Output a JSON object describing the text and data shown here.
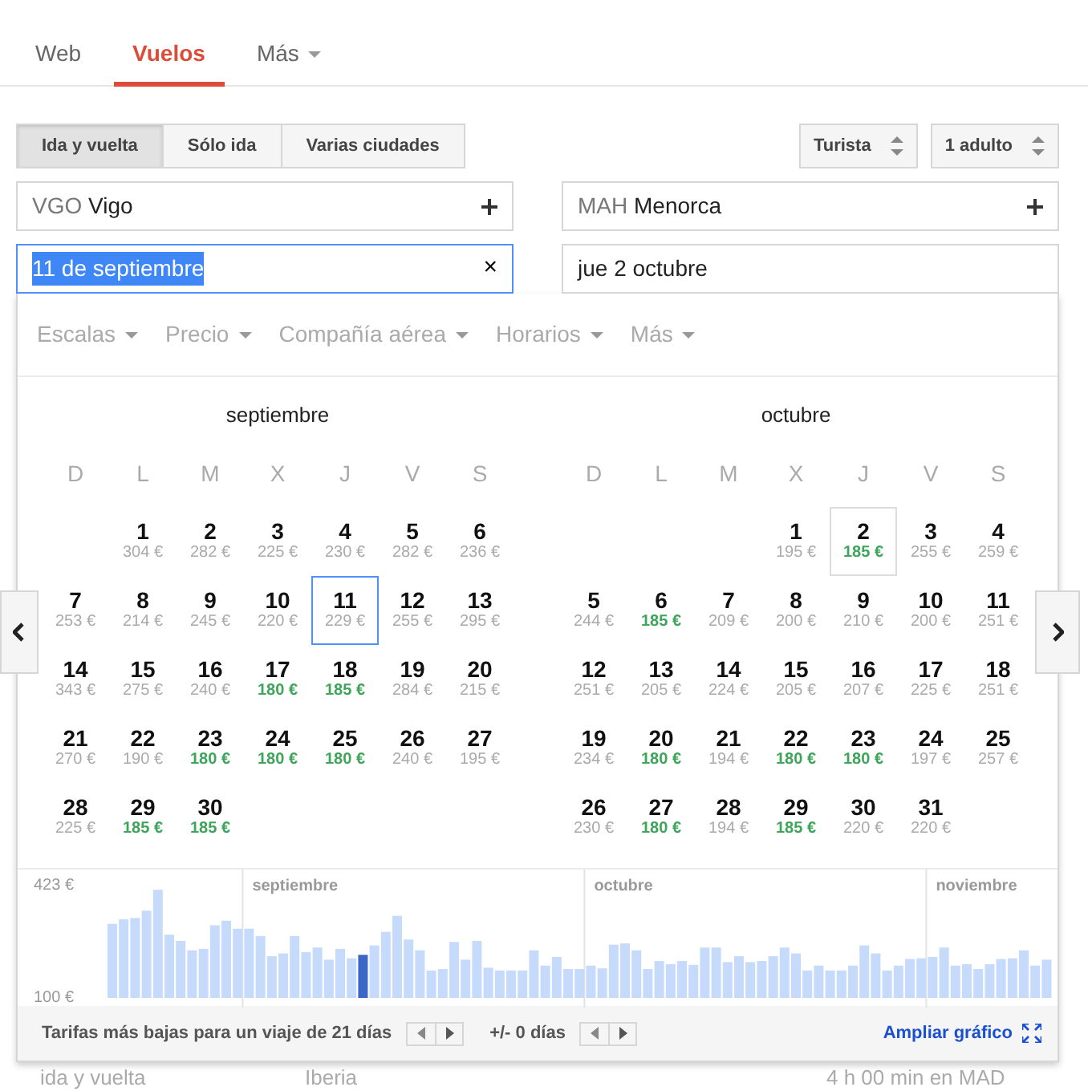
{
  "tabs": [
    {
      "label": "Web",
      "selected": false,
      "dropdown": false
    },
    {
      "label": "Vuelos",
      "selected": true,
      "dropdown": false
    },
    {
      "label": "Más",
      "selected": false,
      "dropdown": true
    }
  ],
  "trip_types": [
    {
      "label": "Ida y vuelta",
      "selected": true
    },
    {
      "label": "Sólo ida",
      "selected": false
    },
    {
      "label": "Varias ciudades",
      "selected": false
    }
  ],
  "selectors": [
    "Turista",
    "1 adulto"
  ],
  "origin": {
    "code": "VGO",
    "city": "Vigo"
  },
  "destination": {
    "code": "MAH",
    "city": "Menorca"
  },
  "departure_date": {
    "value": "11 de septiembre",
    "focused": true,
    "clear": "×"
  },
  "return_date": {
    "value": "jue 2 octubre"
  },
  "filters": [
    "Escalas",
    "Precio",
    "Compañía aérea",
    "Horarios",
    "Más"
  ],
  "months": [
    {
      "name": "septiembre",
      "weekdays": [
        "D",
        "L",
        "M",
        "X",
        "J",
        "V",
        "S"
      ],
      "weeks": [
        [
          {
            "kind": "blank"
          },
          {
            "kind": "day",
            "day": "1",
            "price": "304 €",
            "cheap": false,
            "selected": false,
            "return": false
          },
          {
            "kind": "day",
            "day": "2",
            "price": "282 €",
            "cheap": false,
            "selected": false,
            "return": false
          },
          {
            "kind": "day",
            "day": "3",
            "price": "225 €",
            "cheap": false,
            "selected": false,
            "return": false
          },
          {
            "kind": "day",
            "day": "4",
            "price": "230 €",
            "cheap": false,
            "selected": false,
            "return": false
          },
          {
            "kind": "day",
            "day": "5",
            "price": "282 €",
            "cheap": false,
            "selected": false,
            "return": false
          },
          {
            "kind": "day",
            "day": "6",
            "price": "236 €",
            "cheap": false,
            "selected": false,
            "return": false
          }
        ],
        [
          {
            "kind": "day",
            "day": "7",
            "price": "253 €",
            "cheap": false,
            "selected": false,
            "return": false
          },
          {
            "kind": "day",
            "day": "8",
            "price": "214 €",
            "cheap": false,
            "selected": false,
            "return": false
          },
          {
            "kind": "day",
            "day": "9",
            "price": "245 €",
            "cheap": false,
            "selected": false,
            "return": false
          },
          {
            "kind": "day",
            "day": "10",
            "price": "220 €",
            "cheap": false,
            "selected": false,
            "return": false
          },
          {
            "kind": "day",
            "day": "11",
            "price": "229 €",
            "cheap": false,
            "selected": true,
            "return": false
          },
          {
            "kind": "day",
            "day": "12",
            "price": "255 €",
            "cheap": false,
            "selected": false,
            "return": false
          },
          {
            "kind": "day",
            "day": "13",
            "price": "295 €",
            "cheap": false,
            "selected": false,
            "return": false
          }
        ],
        [
          {
            "kind": "day",
            "day": "14",
            "price": "343 €",
            "cheap": false,
            "selected": false,
            "return": false
          },
          {
            "kind": "day",
            "day": "15",
            "price": "275 €",
            "cheap": false,
            "selected": false,
            "return": false
          },
          {
            "kind": "day",
            "day": "16",
            "price": "240 €",
            "cheap": false,
            "selected": false,
            "return": false
          },
          {
            "kind": "day",
            "day": "17",
            "price": "180 €",
            "cheap": true,
            "selected": false,
            "return": false
          },
          {
            "kind": "day",
            "day": "18",
            "price": "185 €",
            "cheap": true,
            "selected": false,
            "return": false
          },
          {
            "kind": "day",
            "day": "19",
            "price": "284 €",
            "cheap": false,
            "selected": false,
            "return": false
          },
          {
            "kind": "day",
            "day": "20",
            "price": "215 €",
            "cheap": false,
            "selected": false,
            "return": false
          }
        ],
        [
          {
            "kind": "day",
            "day": "21",
            "price": "270 €",
            "cheap": false,
            "selected": false,
            "return": false
          },
          {
            "kind": "day",
            "day": "22",
            "price": "190 €",
            "cheap": false,
            "selected": false,
            "return": false
          },
          {
            "kind": "day",
            "day": "23",
            "price": "180 €",
            "cheap": true,
            "selected": false,
            "return": false
          },
          {
            "kind": "day",
            "day": "24",
            "price": "180 €",
            "cheap": true,
            "selected": false,
            "return": false
          },
          {
            "kind": "day",
            "day": "25",
            "price": "180 €",
            "cheap": true,
            "selected": false,
            "return": false
          },
          {
            "kind": "day",
            "day": "26",
            "price": "240 €",
            "cheap": false,
            "selected": false,
            "return": false
          },
          {
            "kind": "day",
            "day": "27",
            "price": "195 €",
            "cheap": false,
            "selected": false,
            "return": false
          }
        ],
        [
          {
            "kind": "day",
            "day": "28",
            "price": "225 €",
            "cheap": false,
            "selected": false,
            "return": false
          },
          {
            "kind": "day",
            "day": "29",
            "price": "185 €",
            "cheap": true,
            "selected": false,
            "return": false
          },
          {
            "kind": "day",
            "day": "30",
            "price": "185 €",
            "cheap": true,
            "selected": false,
            "return": false
          }
        ]
      ]
    },
    {
      "name": "octubre",
      "weekdays": [
        "D",
        "L",
        "M",
        "X",
        "J",
        "V",
        "S"
      ],
      "weeks": [
        [
          {
            "kind": "blank"
          },
          {
            "kind": "blank"
          },
          {
            "kind": "blank"
          },
          {
            "kind": "day",
            "day": "1",
            "price": "195 €",
            "cheap": false,
            "selected": false,
            "return": false
          },
          {
            "kind": "day",
            "day": "2",
            "price": "185 €",
            "cheap": true,
            "selected": false,
            "return": true
          },
          {
            "kind": "day",
            "day": "3",
            "price": "255 €",
            "cheap": false,
            "selected": false,
            "return": false
          },
          {
            "kind": "day",
            "day": "4",
            "price": "259 €",
            "cheap": false,
            "selected": false,
            "return": false
          }
        ],
        [
          {
            "kind": "day",
            "day": "5",
            "price": "244 €",
            "cheap": false,
            "selected": false,
            "return": false
          },
          {
            "kind": "day",
            "day": "6",
            "price": "185 €",
            "cheap": true,
            "selected": false,
            "return": false
          },
          {
            "kind": "day",
            "day": "7",
            "price": "209 €",
            "cheap": false,
            "selected": false,
            "return": false
          },
          {
            "kind": "day",
            "day": "8",
            "price": "200 €",
            "cheap": false,
            "selected": false,
            "return": false
          },
          {
            "kind": "day",
            "day": "9",
            "price": "210 €",
            "cheap": false,
            "selected": false,
            "return": false
          },
          {
            "kind": "day",
            "day": "10",
            "price": "200 €",
            "cheap": false,
            "selected": false,
            "return": false
          },
          {
            "kind": "day",
            "day": "11",
            "price": "251 €",
            "cheap": false,
            "selected": false,
            "return": false
          }
        ],
        [
          {
            "kind": "day",
            "day": "12",
            "price": "251 €",
            "cheap": false,
            "selected": false,
            "return": false
          },
          {
            "kind": "day",
            "day": "13",
            "price": "205 €",
            "cheap": false,
            "selected": false,
            "return": false
          },
          {
            "kind": "day",
            "day": "14",
            "price": "224 €",
            "cheap": false,
            "selected": false,
            "return": false
          },
          {
            "kind": "day",
            "day": "15",
            "price": "205 €",
            "cheap": false,
            "selected": false,
            "return": false
          },
          {
            "kind": "day",
            "day": "16",
            "price": "207 €",
            "cheap": false,
            "selected": false,
            "return": false
          },
          {
            "kind": "day",
            "day": "17",
            "price": "225 €",
            "cheap": false,
            "selected": false,
            "return": false
          },
          {
            "kind": "day",
            "day": "18",
            "price": "251 €",
            "cheap": false,
            "selected": false,
            "return": false
          }
        ],
        [
          {
            "kind": "day",
            "day": "19",
            "price": "234 €",
            "cheap": false,
            "selected": false,
            "return": false
          },
          {
            "kind": "day",
            "day": "20",
            "price": "180 €",
            "cheap": true,
            "selected": false,
            "return": false
          },
          {
            "kind": "day",
            "day": "21",
            "price": "194 €",
            "cheap": false,
            "selected": false,
            "return": false
          },
          {
            "kind": "day",
            "day": "22",
            "price": "180 €",
            "cheap": true,
            "selected": false,
            "return": false
          },
          {
            "kind": "day",
            "day": "23",
            "price": "180 €",
            "cheap": true,
            "selected": false,
            "return": false
          },
          {
            "kind": "day",
            "day": "24",
            "price": "197 €",
            "cheap": false,
            "selected": false,
            "return": false
          },
          {
            "kind": "day",
            "day": "25",
            "price": "257 €",
            "cheap": false,
            "selected": false,
            "return": false
          }
        ],
        [
          {
            "kind": "day",
            "day": "26",
            "price": "230 €",
            "cheap": false,
            "selected": false,
            "return": false
          },
          {
            "kind": "day",
            "day": "27",
            "price": "180 €",
            "cheap": true,
            "selected": false,
            "return": false
          },
          {
            "kind": "day",
            "day": "28",
            "price": "194 €",
            "cheap": false,
            "selected": false,
            "return": false
          },
          {
            "kind": "day",
            "day": "29",
            "price": "185 €",
            "cheap": true,
            "selected": false,
            "return": false
          },
          {
            "kind": "day",
            "day": "30",
            "price": "220 €",
            "cheap": false,
            "selected": false,
            "return": false
          },
          {
            "kind": "day",
            "day": "31",
            "price": "220 €",
            "cheap": false,
            "selected": false,
            "return": false
          }
        ]
      ]
    }
  ],
  "price_graph": {
    "y_labels": [
      "423 €",
      "100 €"
    ],
    "month_labels": [
      "septiembre",
      "octubre",
      "noviembre"
    ]
  },
  "footer": {
    "trip_length": "Tarifas más bajas para un viaje de 21 días",
    "flex": "+/- 0 días",
    "expand": "Ampliar gráfico"
  },
  "background_result": {
    "trip": "ida y vuelta",
    "airline": "Iberia",
    "layover": "4 h 00 min en MAD"
  }
}
